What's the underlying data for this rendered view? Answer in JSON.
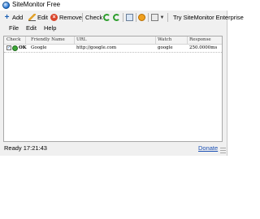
{
  "window": {
    "title": "SiteMonitor Free",
    "icon": "globe-icon"
  },
  "toolbar": {
    "add_label": "Add",
    "edit_label": "Edit",
    "remove_label": "Remove",
    "check_label": "Check",
    "try_label": "Try SiteMonitor Enterprise"
  },
  "menu": [
    "File",
    "Edit",
    "Help"
  ],
  "grid": {
    "columns": [
      "Check",
      "Friendly Name",
      "URL",
      "Watch",
      "Response"
    ],
    "rows": [
      {
        "checked": true,
        "status_icon": "status-ok-icon",
        "status": "OK",
        "friendly_name": "Google",
        "url": "http://google.com",
        "watch": "google",
        "response": "250.0000ms"
      }
    ]
  },
  "status": {
    "text": "Ready 17:21:43",
    "donate_label": "Donate"
  },
  "colors": {
    "accent": "#1a5fb4",
    "ok": "#3fa83a",
    "remove": "#d9452b"
  }
}
